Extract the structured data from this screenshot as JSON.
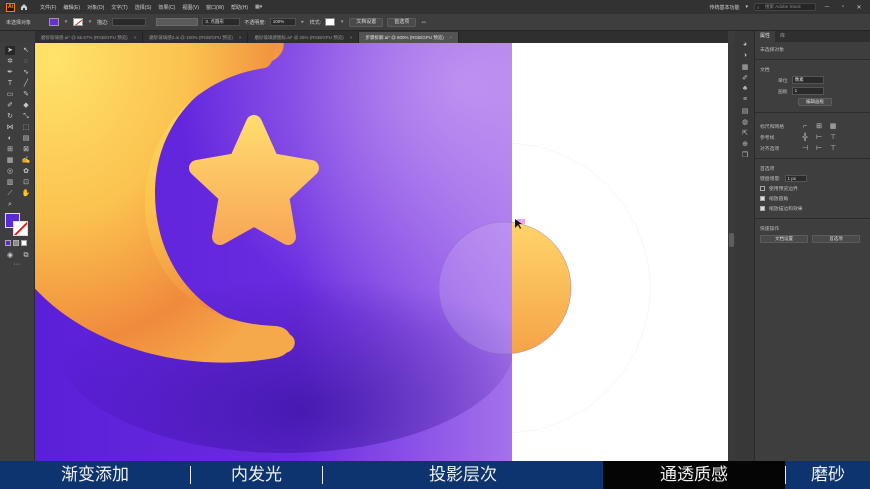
{
  "menubar": {
    "logo": "Ai",
    "items": [
      "文件(F)",
      "编辑(E)",
      "对象(O)",
      "文字(T)",
      "选择(S)",
      "效果(C)",
      "视图(V)",
      "窗口(W)",
      "帮助(H)"
    ],
    "workspace": "传统基本功能",
    "search_placeholder": "搜索 Adobe Stock"
  },
  "control": {
    "selection_label": "未选择对象",
    "stroke_label": "描边:",
    "brush_label": "3. 点圆形",
    "opacity_label": "不透明度:",
    "opacity_value": "100%",
    "style_label": "样式:",
    "doc_setup": "文档设置",
    "preferences": "首选项"
  },
  "tabs": [
    {
      "label": "磨砂玻璃感.ai* @ 66.67% (RGB/GPU 预览)",
      "active": false
    },
    {
      "label": "磨砂玻璃感2.ai @ 150% (RGB/GPU 预览)",
      "active": false
    },
    {
      "label": "磨砂玻璃感图标.ai* @ 25% (RGB/GPU 预览)",
      "active": false
    },
    {
      "label": "步骤拆解.ai* @ 600% (RGB/GPU 预览)",
      "active": true
    }
  ],
  "panel": {
    "tabs": [
      "属性",
      "库"
    ],
    "no_selection": "未选择对象",
    "document": "文档",
    "unit_label": "单位",
    "unit_value": "像素",
    "artboard_label": "画板",
    "artboard_value": "1",
    "edit_artboard": "编辑画板",
    "rulers_grid": "标尺和网格",
    "guides": "参考线",
    "snap": "对齐选项",
    "prefs_title": "首选项",
    "keyboard_increment_label": "键盘增量:",
    "keyboard_increment_value": "1 px",
    "use_preview_bounds": "使用预览边界",
    "scale_corners": "缩放圆角",
    "scale_strokes": "缩放描边和效果",
    "quick_actions": "快速操作",
    "doc_setup_btn": "文档设置",
    "prefs_btn": "首选项"
  },
  "captions": [
    {
      "label": "渐变添加",
      "active": false
    },
    {
      "label": "内发光",
      "active": false
    },
    {
      "label": "投影层次",
      "active": false
    },
    {
      "label": "通透质感",
      "active": true
    },
    {
      "label": "磨砂",
      "active": false
    }
  ],
  "colors": {
    "purple_left": "#5a1fd8",
    "purple_right": "#8d4ae8",
    "moon_yellow": "#ffd65a",
    "moon_orange": "#f08a3c",
    "star_yellow": "#ffd86a",
    "caption_bg": "#0e3470"
  }
}
